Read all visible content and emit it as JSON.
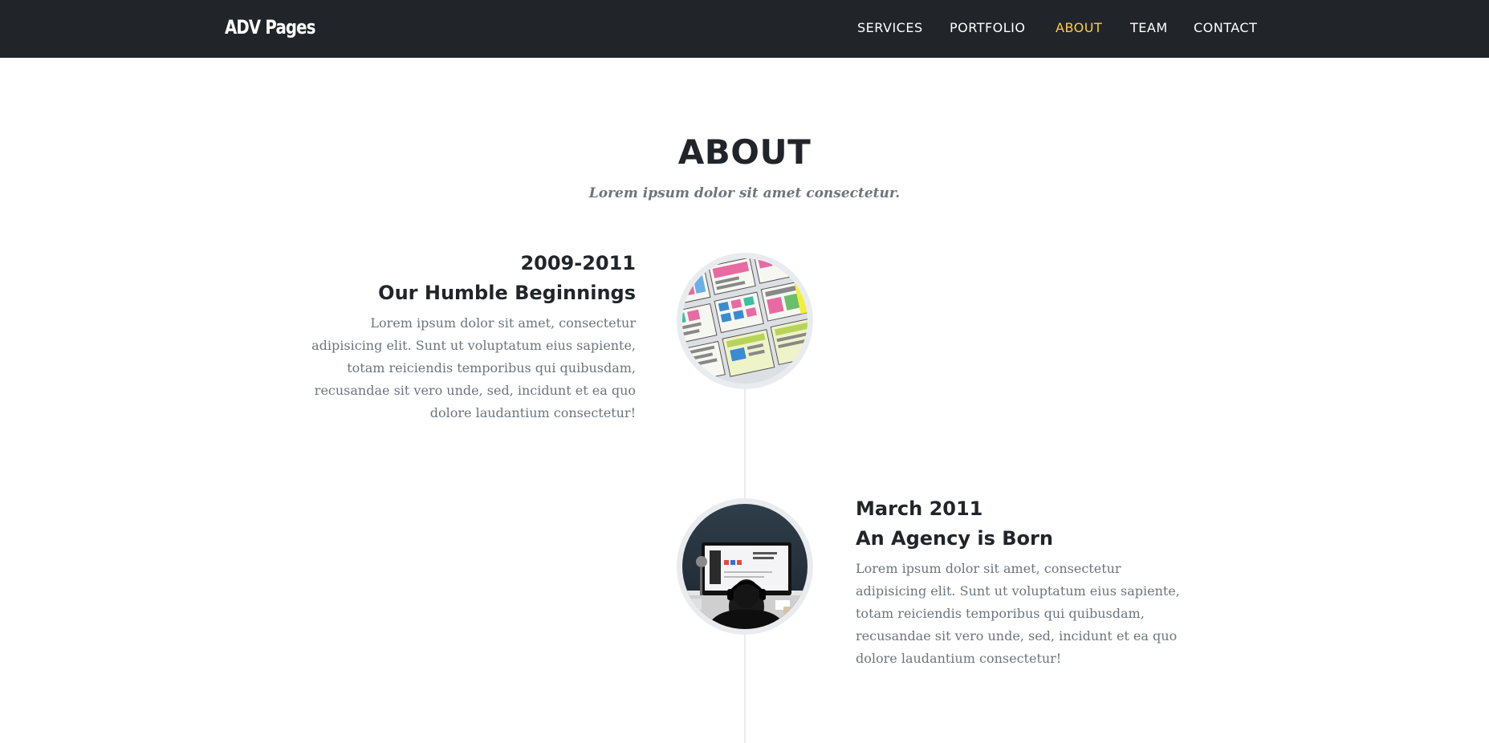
{
  "navbar": {
    "brand": "ADV Pages",
    "links": [
      {
        "label": "SERVICES",
        "active": false
      },
      {
        "label": "PORTFOLIO",
        "active": false
      },
      {
        "label": "ABOUT",
        "active": true
      },
      {
        "label": "TEAM",
        "active": false
      },
      {
        "label": "CONTACT",
        "active": false
      }
    ]
  },
  "about": {
    "heading": "ABOUT",
    "subheading": "Lorem ipsum dolor sit amet consectetur.",
    "timeline": [
      {
        "date": "2009-2011",
        "title": "Our Humble Beginnings",
        "body": "Lorem ipsum dolor sit amet, consectetur adipisicing elit. Sunt ut voluptatum eius sapiente, totam reiciendis temporibus qui quibusdam, recusandae sit vero unde, sed, incidunt et ea quo dolore laudantium consectetur!",
        "image_icon": "wireframe-sketches-image"
      },
      {
        "date": "March 2011",
        "title": "An Agency is Born",
        "body": "Lorem ipsum dolor sit amet, consectetur adipisicing elit. Sunt ut voluptatum eius sapiente, totam reiciendis temporibus qui quibusdam, recusandae sit vero unde, sed, incidunt et ea quo dolore laudantium consectetur!",
        "image_icon": "designer-at-monitor-image"
      }
    ]
  },
  "colors": {
    "navbar_bg": "#212529",
    "accent": "#fed136",
    "text_dark": "#212529",
    "text_muted": "#6c757d",
    "timeline_line": "#e9ecef"
  }
}
